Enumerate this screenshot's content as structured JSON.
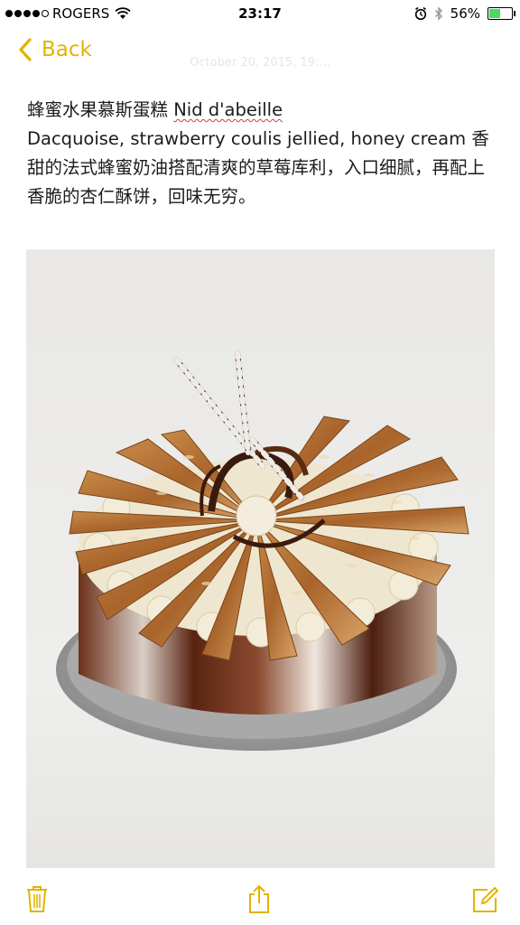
{
  "status": {
    "carrier": "ROGERS",
    "time": "23:17",
    "battery_percent": "56%",
    "battery_level": 0.56,
    "signal_bars_filled": 4,
    "signal_bars_total": 5
  },
  "nav": {
    "back_label": "Back",
    "timestamp": "October 20, 2015, 19:..."
  },
  "note": {
    "title_cn": "蜂蜜水果慕斯蛋糕 ",
    "title_fr": "Nid d'abeille",
    "desc_en": "Dacquoise, strawberry coulis jellied, honey cream ",
    "desc_cn": "香甜的法式蜂蜜奶油搭配清爽的草莓库利，入口细腻，再配上香脆的杏仁酥饼，回味无穷。"
  },
  "photo": {
    "subject": "honey almond florentine mousse cake"
  },
  "toolbar": {
    "trash": "trash-icon",
    "share": "share-icon",
    "compose": "compose-icon"
  },
  "colors": {
    "accent": "#e2b300",
    "text": "#1c1c1c",
    "spellcheck": "#d43b3b"
  }
}
